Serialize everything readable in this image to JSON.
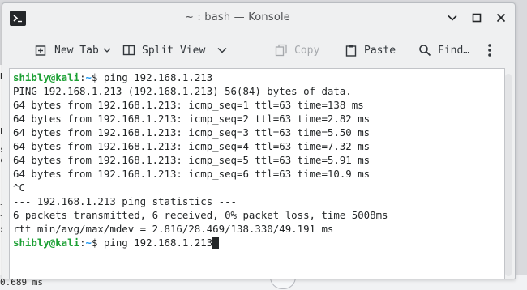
{
  "window": {
    "title": "~ : bash — Konsole"
  },
  "toolbar": {
    "new_tab": "New Tab",
    "split_view": "Split View",
    "copy": "Copy",
    "paste": "Paste",
    "find": "Find…"
  },
  "background": {
    "left_glyphs": [
      "B",
      "b",
      "s",
      "c",
      "t",
      "",
      "t",
      "t",
      "s"
    ],
    "bottom_text": "0.689 ms"
  },
  "terminal": {
    "prompt_user": "shibly@kali",
    "prompt_path": "~",
    "prompt_symbol": "$",
    "command_1": " ping 192.168.1.213",
    "output": [
      "PING 192.168.1.213 (192.168.1.213) 56(84) bytes of data.",
      "64 bytes from 192.168.1.213: icmp_seq=1 ttl=63 time=138 ms",
      "64 bytes from 192.168.1.213: icmp_seq=2 ttl=63 time=2.82 ms",
      "64 bytes from 192.168.1.213: icmp_seq=3 ttl=63 time=5.50 ms",
      "64 bytes from 192.168.1.213: icmp_seq=4 ttl=63 time=7.32 ms",
      "64 bytes from 192.168.1.213: icmp_seq=5 ttl=63 time=5.91 ms",
      "64 bytes from 192.168.1.213: icmp_seq=6 ttl=63 time=10.9 ms",
      "^C",
      "--- 192.168.1.213 ping statistics ---",
      "6 packets transmitted, 6 received, 0% packet loss, time 5008ms",
      "rtt min/avg/max/mdev = 2.816/28.469/138.330/49.191 ms"
    ],
    "command_2": " ping 192.168.1.213"
  },
  "colors": {
    "prompt_user": "#1ca034",
    "prompt_path": "#1d99f3",
    "text": "#232627"
  }
}
